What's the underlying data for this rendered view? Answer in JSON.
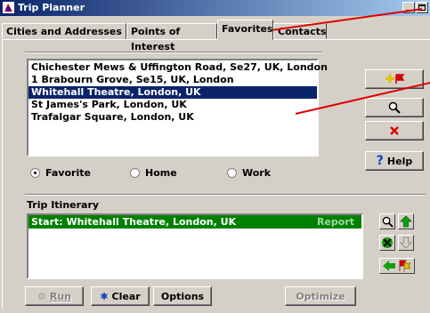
{
  "window": {
    "title": "Trip Planner"
  },
  "tabs": [
    {
      "label": "Cities and Addresses"
    },
    {
      "label": "Points of Interest"
    },
    {
      "label": "Favorites",
      "active": true
    },
    {
      "label": "Contacts"
    }
  ],
  "favorites": {
    "items": [
      "Chichester Mews & Uffington Road, Se27, UK, London",
      "1 Brabourn Grove, Se15, UK, London",
      "Whitehall Theatre, London, UK",
      "St James's Park, London, UK",
      "Trafalgar Square, London, UK"
    ],
    "selected_index": 2
  },
  "side_buttons": {
    "help_label": "Help"
  },
  "radio": {
    "options": [
      "Favorite",
      "Home",
      "Work"
    ],
    "checked": "Favorite"
  },
  "itinerary": {
    "label": "Trip Itinerary",
    "rows": [
      {
        "text": "Start: Whitehall Theatre, London, UK",
        "action": "Report"
      }
    ]
  },
  "bottom_buttons": {
    "run": "Run",
    "clear": "Clear",
    "options": "Options",
    "optimize": "Optimize"
  },
  "colors": {
    "selection": "#0a246a",
    "itinerary_row": "#008000",
    "annotation": "#e00000"
  }
}
